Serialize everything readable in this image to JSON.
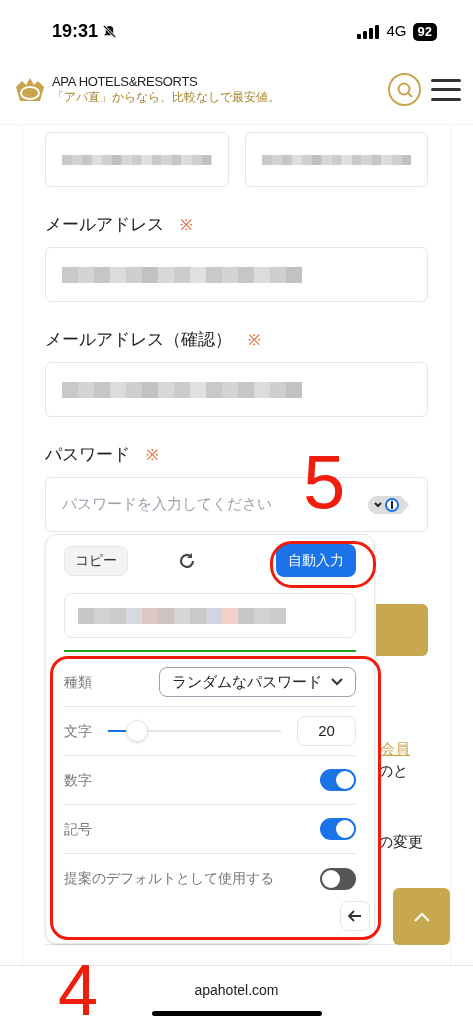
{
  "status_bar": {
    "time": "19:31",
    "network": "4G",
    "battery": "92"
  },
  "header": {
    "brand": "APA HOTELS&RESORTS",
    "tagline": "「アパ直」からなら、比較なしで最安値。"
  },
  "form": {
    "name_fields": [
      {
        "kind": "redacted"
      },
      {
        "kind": "redacted"
      }
    ],
    "fields": [
      {
        "label": "メールアドレス",
        "required_mark": "※",
        "kind": "redacted"
      },
      {
        "label": "メールアドレス（確認）",
        "required_mark": "※",
        "kind": "redacted"
      },
      {
        "label": "パスワード",
        "required_mark": "※",
        "kind": "password",
        "placeholder": "パスワードを入力してください"
      }
    ]
  },
  "password_popup": {
    "copy_button": "コピー",
    "autofill_button": "自動入力",
    "settings": [
      {
        "kind": "select",
        "label": "種類",
        "value": "ランダムなパスワード"
      },
      {
        "kind": "slider",
        "label": "文字",
        "level": 0.17,
        "value": "20"
      },
      {
        "kind": "toggle",
        "label": "数字",
        "on": true
      },
      {
        "kind": "toggle",
        "label": "記号",
        "on": true
      },
      {
        "kind": "toggle",
        "label": "提案のデフォルトとして使用する",
        "on": false
      }
    ]
  },
  "background_text": [
    {
      "text": "会員",
      "kind": "link"
    },
    {
      "text": "のと",
      "kind": "plain"
    },
    {
      "text": "の変更",
      "kind": "plain"
    }
  ],
  "url_bar": {
    "url": "apahotel.com"
  },
  "annotations": [
    {
      "text": "5"
    },
    {
      "text": "4"
    }
  ]
}
